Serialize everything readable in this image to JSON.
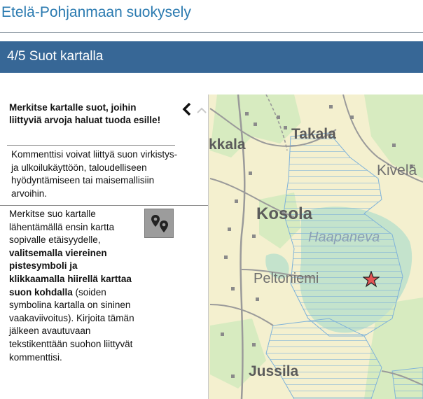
{
  "header": {
    "title": "Etelä-Pohjanmaan suokysely"
  },
  "step": {
    "label": "4/5 Suot kartalla"
  },
  "panel": {
    "heading": "Merkitse kartalle suot, joihin liittyviä arvoja haluat tuoda esille!",
    "comment_note": "Kommenttisi voivat liittyä suon virkistys- ja ulkoilukäyttöön, taloudelliseen hyödyntämiseen tai maisemallisiin arvoihin.",
    "instr_part1": "Merkitse suo kartalle lähentämällä ensin kartta sopivalle etäisyydelle, ",
    "instr_bold": "valitsemalla viereinen pistesymboli ja klikkaamalla hiirellä karttaa suon kohdalla",
    "instr_part2": " (soiden symbolina kartalla on sininen vaakaviivoitus). Kirjoita tämän jälkeen avautuvaan tekstikenttään suohon liittyvät kommenttisi.",
    "tool_icon": "map-pins-icon",
    "collapse_icon": "chevron-left-icon"
  },
  "map": {
    "places": {
      "kokkala": "kkala",
      "takala": "Takala",
      "kivela": "Kivelä",
      "kosola": "Kosola",
      "haapaneva": "Haapaneva",
      "peltoniemi": "Peltoniemi",
      "jussila": "Jussila"
    },
    "marker_icon": "star-marker-icon",
    "colors": {
      "fields": "#f4f0cf",
      "forest": "#d7ebc0",
      "bog_fill": "#c4e3cc",
      "hatch": "#7fb2d9",
      "roads": "#9a9a9a",
      "marker": "#e35454"
    }
  }
}
